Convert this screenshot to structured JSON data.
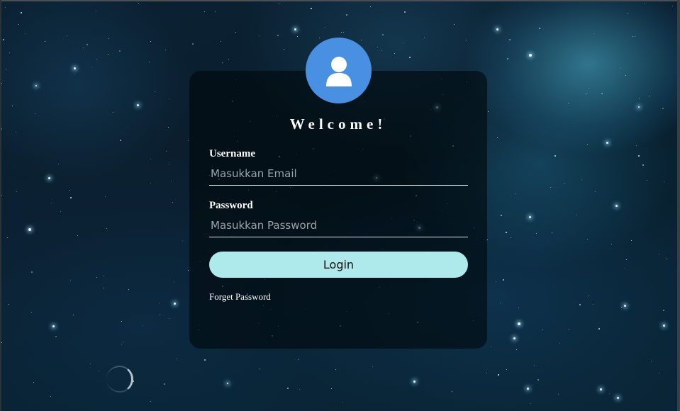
{
  "login": {
    "welcome_title": "Welcome!",
    "username_label": "Username",
    "username_placeholder": "Masukkan Email",
    "password_label": "Password",
    "password_placeholder": "Masukkan Password",
    "login_button": "Login",
    "forget_link": "Forget Password"
  },
  "icons": {
    "avatar": "user-icon"
  },
  "colors": {
    "avatar_bg": "#4a90e2",
    "button_bg": "#aee9ec",
    "card_bg": "rgba(0,8,12,0.62)",
    "text": "#ffffff"
  }
}
